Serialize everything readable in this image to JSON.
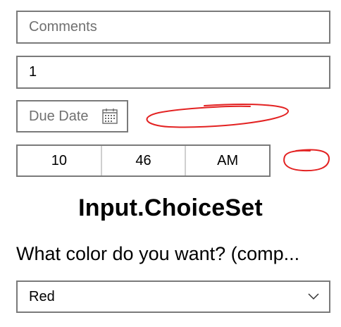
{
  "form": {
    "comments": {
      "placeholder": "Comments"
    },
    "number": {
      "value": "1"
    },
    "due_date": {
      "placeholder": "Due Date",
      "icon": "calendar-icon"
    },
    "time_picker": {
      "hour": "10",
      "minute": "46",
      "period": "AM"
    },
    "choice_set": {
      "heading": "Input.ChoiceSet",
      "question": "What color do you want? (comp...",
      "selected": "Red",
      "icon": "chevron-down-icon"
    }
  },
  "annotation_color": "#e32222"
}
